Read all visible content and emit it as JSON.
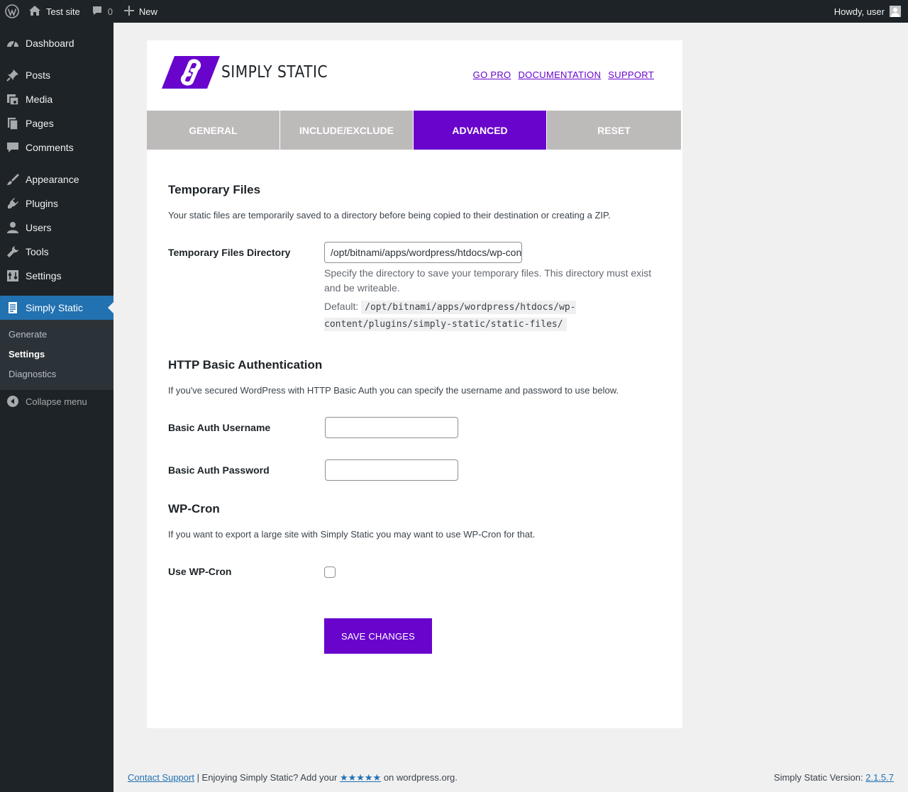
{
  "adminbar": {
    "site_name": "Test site",
    "comment_count": "0",
    "new_label": "New",
    "greeting": "Howdy, user"
  },
  "sidebar": {
    "items": [
      {
        "label": "Dashboard",
        "icon": "dashboard-icon"
      },
      {
        "label": "Posts",
        "icon": "pin-icon"
      },
      {
        "label": "Media",
        "icon": "media-icon"
      },
      {
        "label": "Pages",
        "icon": "pages-icon"
      },
      {
        "label": "Comments",
        "icon": "comments-icon"
      },
      {
        "label": "Appearance",
        "icon": "brush-icon"
      },
      {
        "label": "Plugins",
        "icon": "plug-icon"
      },
      {
        "label": "Users",
        "icon": "user-icon"
      },
      {
        "label": "Tools",
        "icon": "wrench-icon"
      },
      {
        "label": "Settings",
        "icon": "settings-icon"
      },
      {
        "label": "Simply Static",
        "icon": "document-icon"
      }
    ],
    "submenu": [
      "Generate",
      "Settings",
      "Diagnostics"
    ],
    "collapse_label": "Collapse menu"
  },
  "header": {
    "logo_text": "SIMPLY STATIC",
    "links": [
      "GO PRO",
      "DOCUMENTATION",
      "SUPPORT"
    ]
  },
  "tabs": [
    "GENERAL",
    "INCLUDE/EXCLUDE",
    "ADVANCED",
    "RESET"
  ],
  "temp_files": {
    "title": "Temporary Files",
    "desc": "Your static files are temporarily saved to a directory before being copied to their destination or creating a ZIP.",
    "dir_label": "Temporary Files Directory",
    "dir_value": "/opt/bitnami/apps/wordpress/htdocs/wp-content/plugins/simply-static/static-files/",
    "help": "Specify the directory to save your temporary files. This directory must exist and be writeable.",
    "default_label": "Default:",
    "default_value": "/opt/bitnami/apps/wordpress/htdocs/wp-content/plugins/simply-static/static-files/"
  },
  "basic_auth": {
    "title": "HTTP Basic Authentication",
    "desc": "If you've secured WordPress with HTTP Basic Auth you can specify the username and password to use below.",
    "username_label": "Basic Auth Username",
    "username_value": "",
    "password_label": "Basic Auth Password",
    "password_value": ""
  },
  "wp_cron": {
    "title": "WP-Cron",
    "desc": "If you want to export a large site with Simply Static you may want to use WP-Cron for that.",
    "label": "Use WP-Cron",
    "checked": false
  },
  "save_label": "SAVE CHANGES",
  "footer": {
    "contact_link": "Contact Support",
    "enjoy_text": " | Enjoying Simply Static? Add your ",
    "stars": "★★★★★",
    "on_text": " on wordpress.org.",
    "version_label": "Simply Static Version: ",
    "version": "2.1.5.7"
  },
  "colors": {
    "brand_purple": "#6804cc",
    "wp_blue": "#2271b1",
    "admin_dark": "#1d2327",
    "tab_gray": "#bdbaba"
  }
}
